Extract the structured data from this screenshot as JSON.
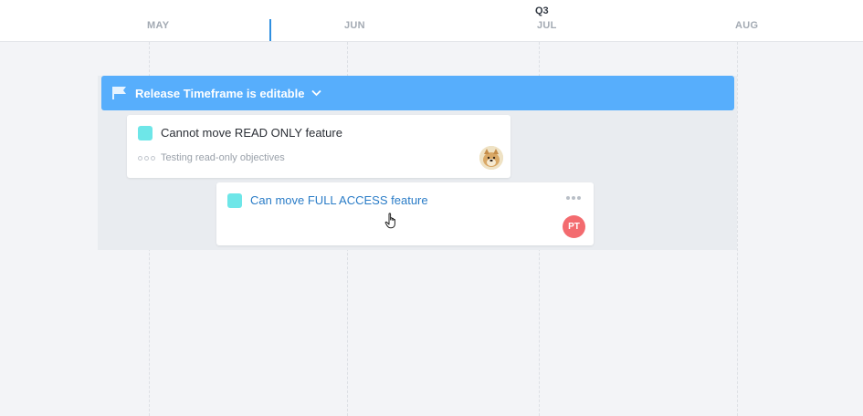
{
  "timeline": {
    "quarter": "Q3",
    "months": [
      "MAY",
      "JUN",
      "JUL",
      "AUG"
    ]
  },
  "release": {
    "title": "Release Timeframe is editable",
    "icon": "flag-icon",
    "color": "#57aefc"
  },
  "features": [
    {
      "title": "Cannot move READ ONLY feature",
      "color": "#6ee6e8",
      "objective": "Testing read-only objectives",
      "avatar": "doge-avatar"
    },
    {
      "title": "Can move FULL ACCESS feature",
      "color": "#6ee6e8",
      "avatar_initials": "PT",
      "avatar_color": "#f36b6f"
    }
  ],
  "colors": {
    "today_marker": "#2f8fe0",
    "link_title": "#2a7cc7"
  }
}
